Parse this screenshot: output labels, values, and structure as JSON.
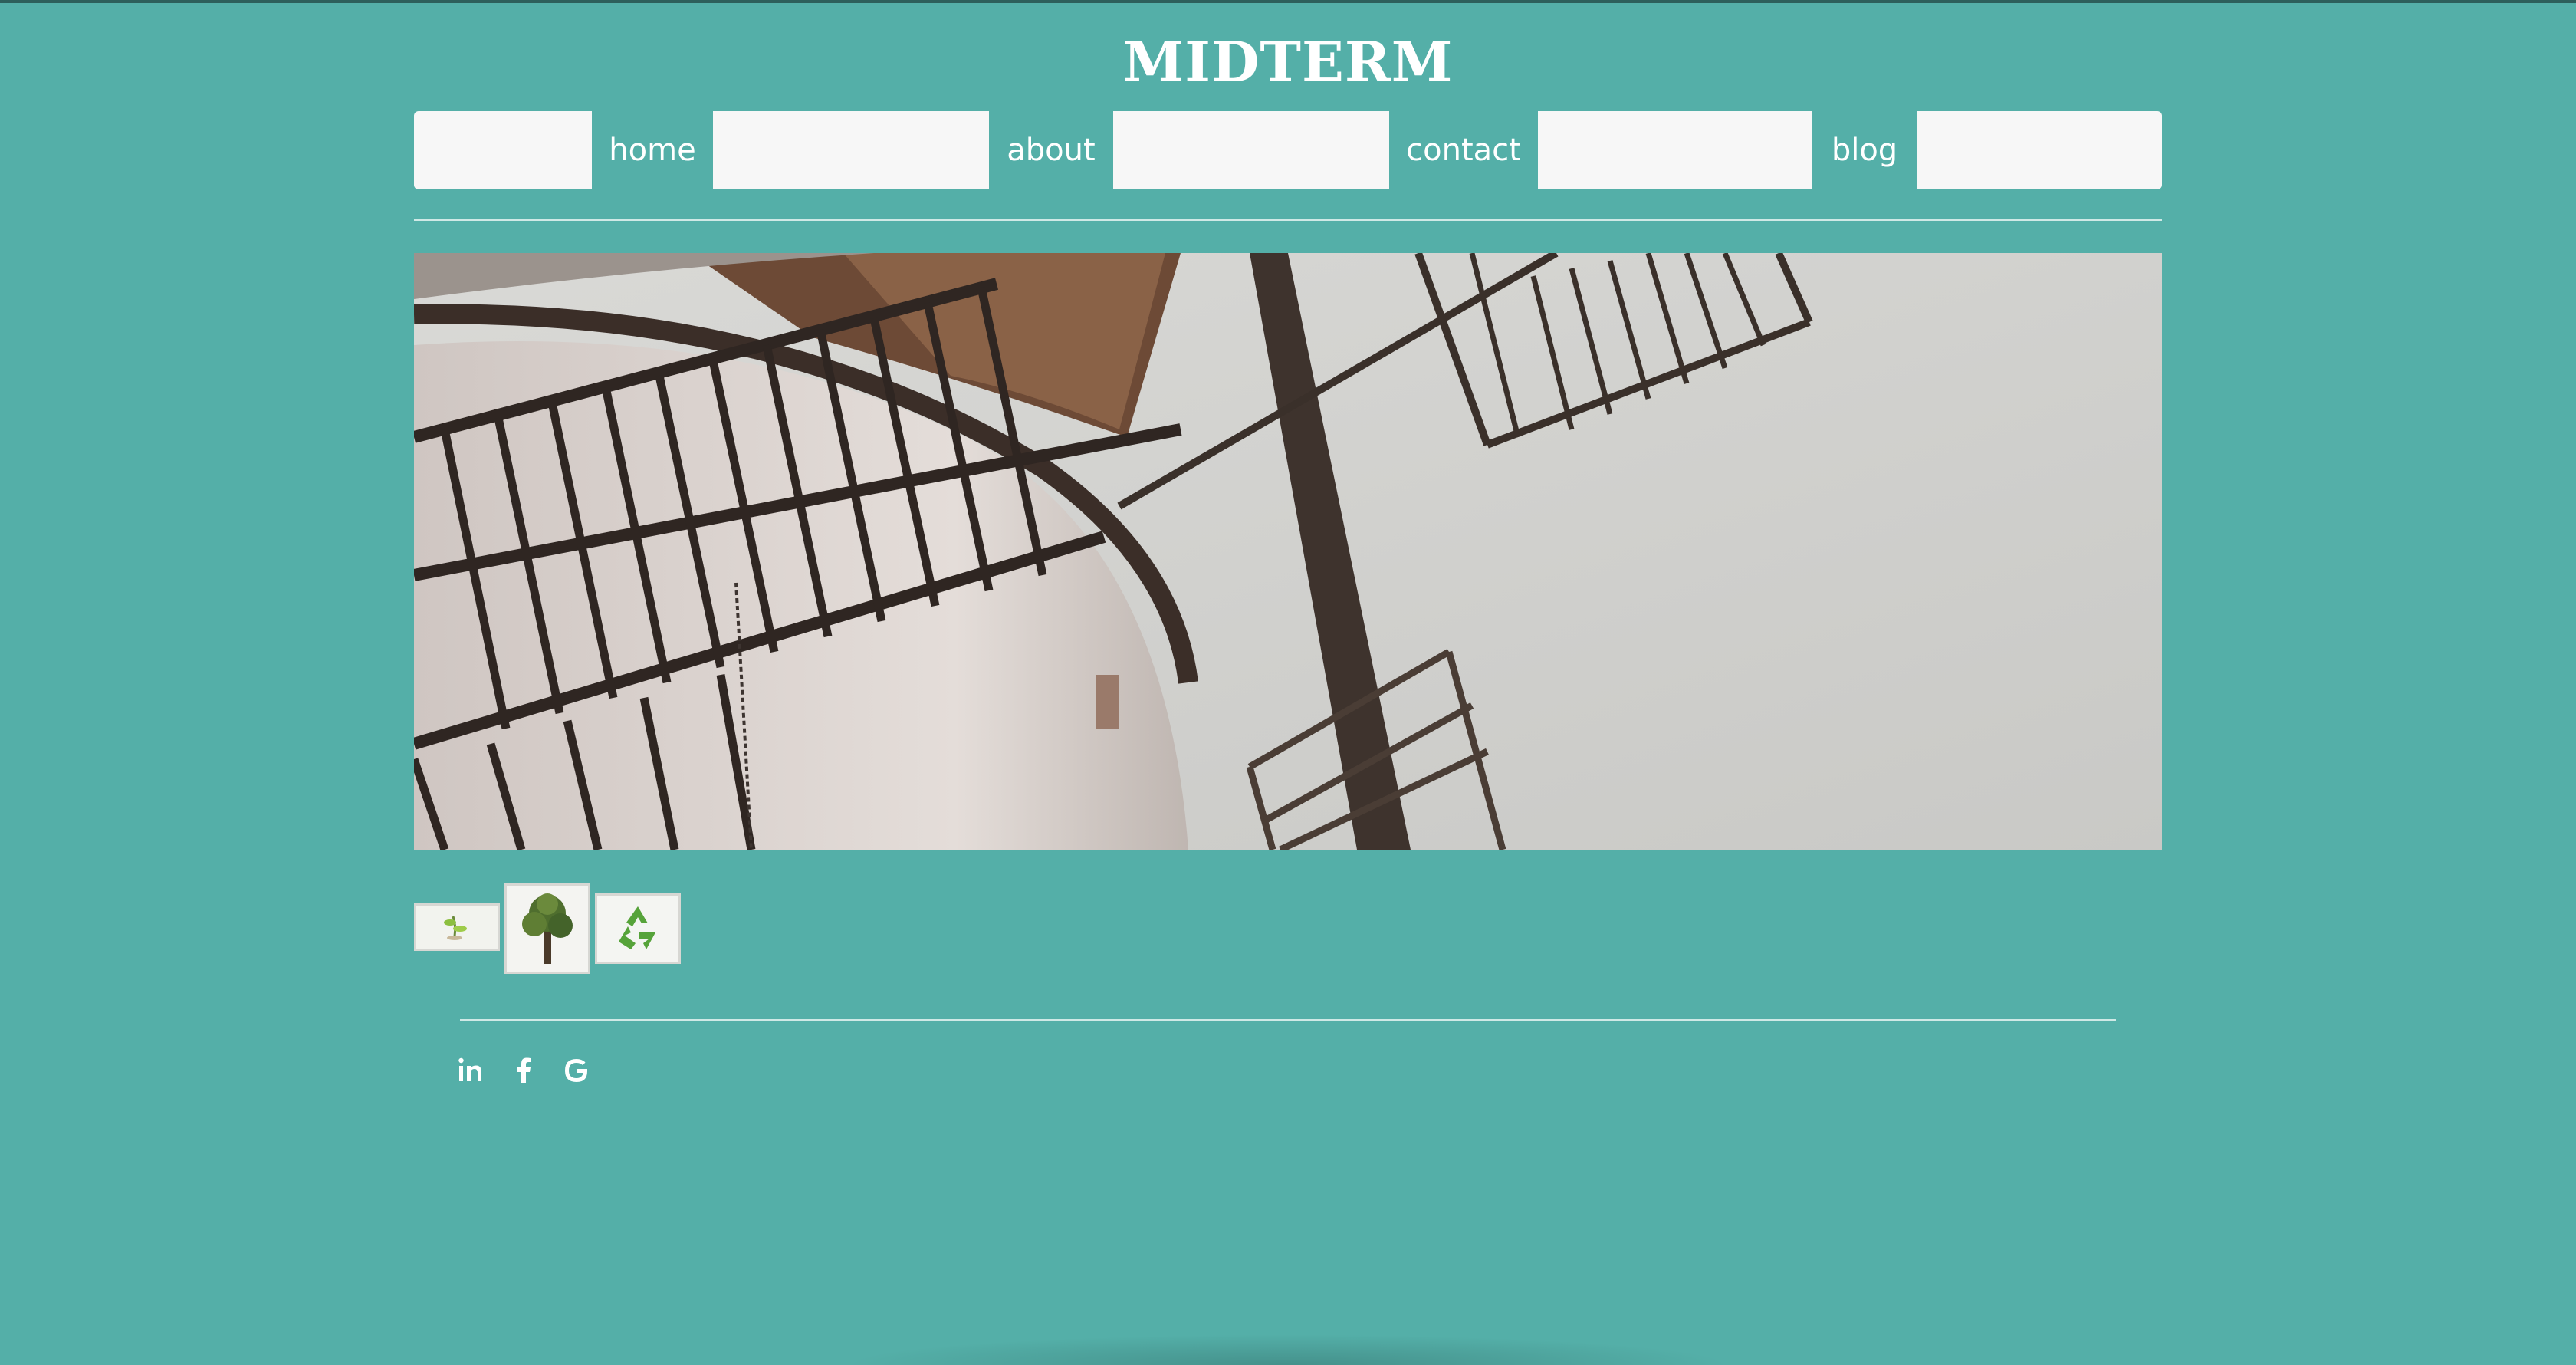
{
  "site": {
    "title": "MIDTERM"
  },
  "nav": {
    "items": [
      {
        "label": "home"
      },
      {
        "label": "about"
      },
      {
        "label": "contact"
      },
      {
        "label": "blog"
      }
    ]
  },
  "hero": {
    "image_icon": "windmill-photo"
  },
  "gallery": {
    "thumbnails": [
      {
        "icon": "plant-sprout-thumbnail"
      },
      {
        "icon": "tree-thumbnail"
      },
      {
        "icon": "recycle-thumbnail"
      }
    ]
  },
  "footer": {
    "social": [
      {
        "icon": "linkedin-icon"
      },
      {
        "icon": "facebook-icon"
      },
      {
        "icon": "google-icon"
      }
    ]
  },
  "colors": {
    "background": "#54afa8",
    "navbar": "#f7f7f7",
    "accent": "#54afa8",
    "text": "#ffffff"
  }
}
